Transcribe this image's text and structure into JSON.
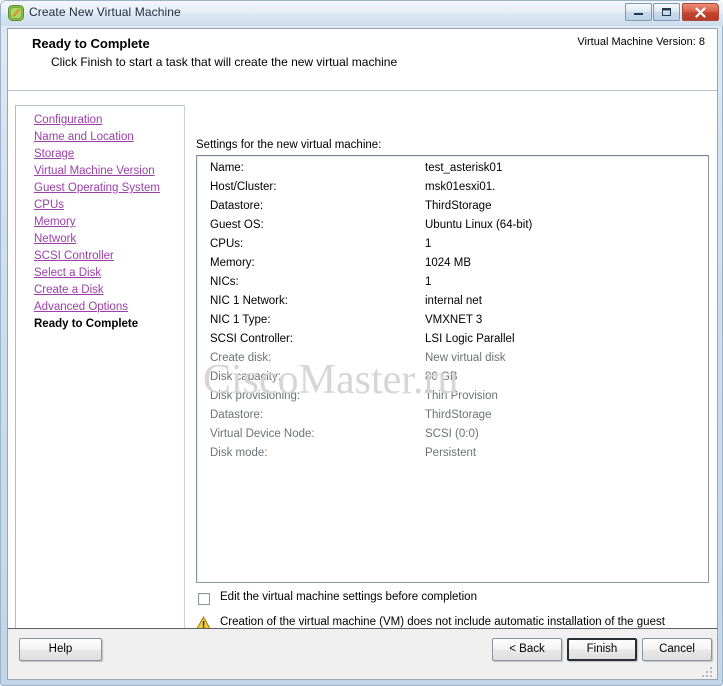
{
  "window": {
    "title": "Create New Virtual Machine",
    "app_icon": "vm-app-icon",
    "minimize_label": "",
    "maximize_label": "",
    "close_label": ""
  },
  "header": {
    "title": "Ready to Complete",
    "subtitle": "Click Finish to start a task that will create the new virtual machine",
    "version_label": "Virtual Machine Version: 8"
  },
  "sidebar": {
    "items": [
      {
        "label": "Configuration",
        "current": false
      },
      {
        "label": "Name and Location",
        "current": false
      },
      {
        "label": "Storage",
        "current": false
      },
      {
        "label": "Virtual Machine Version",
        "current": false
      },
      {
        "label": "Guest Operating System",
        "current": false
      },
      {
        "label": "CPUs",
        "current": false
      },
      {
        "label": "Memory",
        "current": false
      },
      {
        "label": "Network",
        "current": false
      },
      {
        "label": "SCSI Controller",
        "current": false
      },
      {
        "label": "Select a Disk",
        "current": false
      },
      {
        "label": "Create a Disk",
        "current": false
      },
      {
        "label": "Advanced Options",
        "current": false
      },
      {
        "label": "Ready to Complete",
        "current": true
      }
    ]
  },
  "main": {
    "settings_caption": "Settings for the new virtual machine:",
    "watermark": "CiscoMaster.ru",
    "settings": [
      {
        "label": "Name:",
        "value": "test_asterisk01",
        "dim": false
      },
      {
        "label": "Host/Cluster:",
        "value": "msk01esxi01.",
        "dim": false
      },
      {
        "label": "Datastore:",
        "value": "ThirdStorage",
        "dim": false
      },
      {
        "label": "Guest OS:",
        "value": "Ubuntu Linux (64-bit)",
        "dim": false
      },
      {
        "label": "CPUs:",
        "value": "1",
        "dim": false
      },
      {
        "label": "Memory:",
        "value": "1024 MB",
        "dim": false
      },
      {
        "label": "NICs:",
        "value": "1",
        "dim": false
      },
      {
        "label": "NIC 1 Network:",
        "value": "internal net",
        "dim": false
      },
      {
        "label": "NIC 1 Type:",
        "value": "VMXNET 3",
        "dim": false
      },
      {
        "label": "SCSI Controller:",
        "value": "LSI Logic Parallel",
        "dim": false
      },
      {
        "label": "Create disk:",
        "value": "New virtual disk",
        "dim": true
      },
      {
        "label": "Disk capacity:",
        "value": "80 GB",
        "dim": true
      },
      {
        "label": "Disk provisioning:",
        "value": "Thin Provision",
        "dim": true
      },
      {
        "label": "Datastore:",
        "value": "ThirdStorage",
        "dim": true
      },
      {
        "label": "Virtual Device Node:",
        "value": "SCSI (0:0)",
        "dim": true
      },
      {
        "label": "Disk mode:",
        "value": "Persistent",
        "dim": true
      }
    ],
    "edit_before_completion": {
      "label": "Edit the virtual machine settings before completion",
      "checked": false
    },
    "warning": {
      "icon": "warning-triangle-icon",
      "text": "Creation of the virtual machine (VM) does not include automatic installation of the guest operating system. Install a guest OS on the VM after creating the VM."
    }
  },
  "footer": {
    "help_label": "Help",
    "back_label": "< Back",
    "finish_label": "Finish",
    "cancel_label": "Cancel"
  },
  "colors": {
    "link": "#9c3fa8",
    "dim_text": "#6e7277",
    "warning": "#e8b511",
    "close_button": "#c24530",
    "watermark": "#d6d6d6"
  }
}
